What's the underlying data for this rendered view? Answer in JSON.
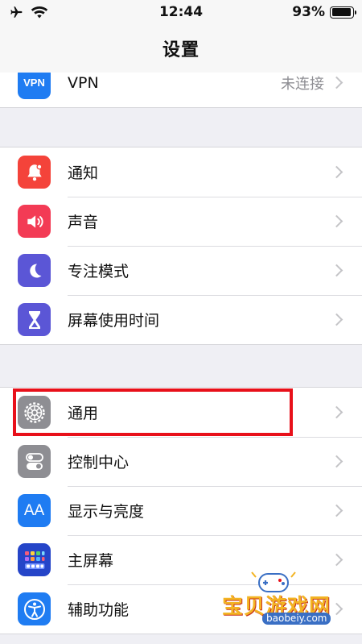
{
  "status_bar": {
    "time": "12:44",
    "battery": "93%",
    "battery_level": 0.93
  },
  "nav": {
    "title": "设置"
  },
  "groups": [
    {
      "rows": [
        {
          "label": "VPN",
          "value": "未连接",
          "icon": "vpn-icon",
          "icon_text": "VPN",
          "color": "#1f7cf2"
        }
      ]
    },
    {
      "rows": [
        {
          "label": "通知",
          "icon": "bell-icon",
          "color": "#f4433a"
        },
        {
          "label": "声音",
          "icon": "speaker-icon",
          "color": "#f33b55"
        },
        {
          "label": "专注模式",
          "icon": "moon-icon",
          "color": "#5b56d6"
        },
        {
          "label": "屏幕使用时间",
          "icon": "hourglass-icon",
          "color": "#5b56d6"
        }
      ]
    },
    {
      "rows": [
        {
          "label": "通用",
          "icon": "gear-icon",
          "color": "#8e8e93"
        },
        {
          "label": "控制中心",
          "icon": "toggles-icon",
          "color": "#8e8e93"
        },
        {
          "label": "显示与亮度",
          "icon": "text-size-icon",
          "icon_text": "AA",
          "color": "#1f7cf2"
        },
        {
          "label": "主屏幕",
          "icon": "home-screen-icon",
          "color": "#2545c8"
        },
        {
          "label": "辅助功能",
          "icon": "accessibility-icon",
          "color": "#1f7cf2"
        }
      ]
    }
  ],
  "watermark": {
    "text": "宝贝游戏网",
    "url": "baobeiy.com"
  },
  "colors": {
    "highlight": "#e8101a",
    "background": "#efeff4"
  }
}
